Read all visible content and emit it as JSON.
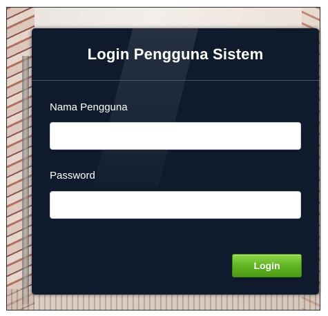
{
  "login": {
    "title": "Login Pengguna Sistem",
    "username_label": "Nama Pengguna",
    "username_value": "",
    "password_label": "Password",
    "password_value": "",
    "login_button_label": "Login"
  },
  "colors": {
    "panel_background": "#0f1b2c",
    "button_green": "#5cb21e",
    "text": "#ffffff"
  }
}
